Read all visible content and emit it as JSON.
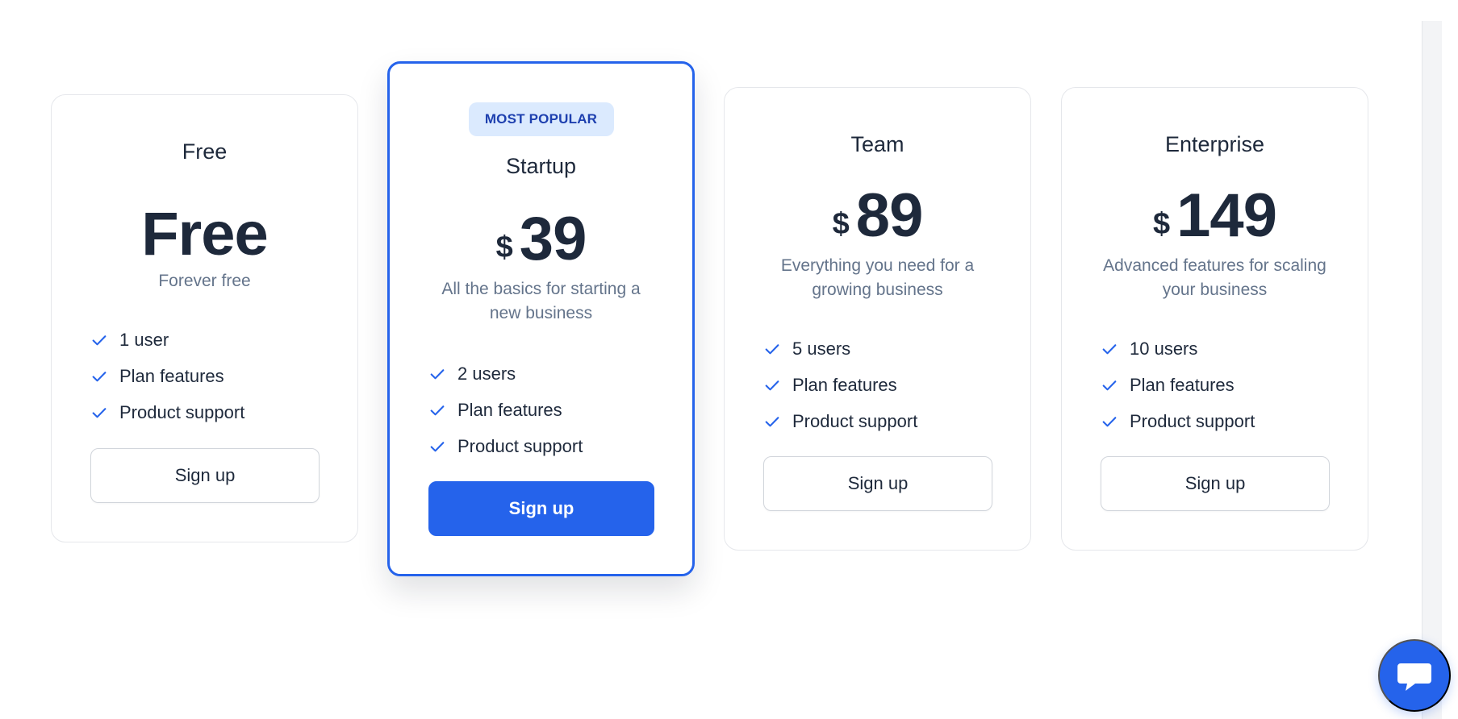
{
  "accent_color": "#2563eb",
  "plans": [
    {
      "name": "Free",
      "price_text": "Free",
      "description": "Forever free",
      "features": [
        "1 user",
        "Plan features",
        "Product support"
      ],
      "button_label": "Sign up"
    },
    {
      "badge": "MOST POPULAR",
      "name": "Startup",
      "currency": "$",
      "price": "39",
      "description": "All the basics for starting a new business",
      "features": [
        "2 users",
        "Plan features",
        "Product support"
      ],
      "button_label": "Sign up"
    },
    {
      "name": "Team",
      "currency": "$",
      "price": "89",
      "description": "Everything you need for a growing business",
      "features": [
        "5 users",
        "Plan features",
        "Product support"
      ],
      "button_label": "Sign up"
    },
    {
      "name": "Enterprise",
      "currency": "$",
      "price": "149",
      "description": "Advanced features for scaling your business",
      "features": [
        "10 users",
        "Plan features",
        "Product support"
      ],
      "button_label": "Sign up"
    }
  ],
  "icons": {
    "feature": "check-icon",
    "chat": "chat-bubble-icon"
  }
}
